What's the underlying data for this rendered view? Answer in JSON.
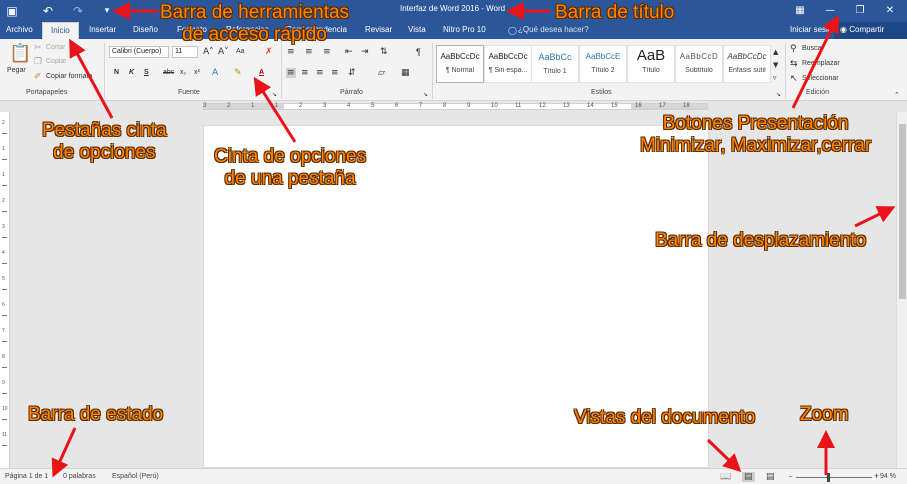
{
  "window": {
    "title": "Interfaz de Word 2016 - Word",
    "sign_in": "Iniciar sesión",
    "share": "Compartir",
    "tell_me": "¿Qué desea hacer?",
    "accent_color": "#2b579a"
  },
  "quick_access": {
    "save_icon": "save-icon",
    "undo_icon": "undo-icon",
    "redo_icon": "redo-icon",
    "customize_icon": "customize-icon"
  },
  "window_controls": {
    "ribbon_display_icon": "ribbon-display-icon",
    "minimize_icon": "minimize-icon",
    "restore_icon": "restore-icon",
    "close_icon": "close-icon"
  },
  "tabs": [
    {
      "label": "Archivo"
    },
    {
      "label": "Inicio"
    },
    {
      "label": "Insertar"
    },
    {
      "label": "Diseño"
    },
    {
      "label": "Formato"
    },
    {
      "label": "Referencias"
    },
    {
      "label": "Correspondencia"
    },
    {
      "label": "Revisar"
    },
    {
      "label": "Vista"
    },
    {
      "label": "Nitro Pro 10"
    }
  ],
  "ribbon": {
    "clipboard": {
      "paste": "Pegar",
      "cut": "Cortar",
      "copy": "Copiar",
      "format_painter": "Copiar formato",
      "group_label": "Portapapeles"
    },
    "font": {
      "font_name": "Calibri (Cuerpo)",
      "font_size": "11",
      "change_case": "Aa",
      "bold": "N",
      "italic": "K",
      "underline": "S",
      "strikethrough": "abc",
      "subscript": "x₂",
      "superscript": "x²",
      "text_color": "A",
      "group_label": "Fuente"
    },
    "paragraph": {
      "pilcrow": "¶",
      "group_label": "Párrafo"
    },
    "styles": {
      "items": [
        {
          "sample": "AaBbCcDc",
          "name": "¶ Normal"
        },
        {
          "sample": "AaBbCcDc",
          "name": "¶ Sin espa..."
        },
        {
          "sample": "AaBbCc",
          "name": "Título 1"
        },
        {
          "sample": "AaBbCcE",
          "name": "Título 2"
        },
        {
          "sample": "AaB",
          "name": "Título"
        },
        {
          "sample": "AaBbCcD",
          "name": "Subtítulo"
        },
        {
          "sample": "AaBbCcDc",
          "name": "Énfasis sutil"
        }
      ],
      "group_label": "Estilos"
    },
    "editing": {
      "find": "Buscar",
      "replace": "Reemplazar",
      "select": "Seleccionar",
      "group_label": "Edición"
    }
  },
  "ruler": {
    "h_labels": [
      "3",
      "2",
      "1",
      "1",
      "2",
      "3",
      "4",
      "5",
      "6",
      "7",
      "8",
      "9",
      "10",
      "11",
      "12",
      "13",
      "14",
      "15",
      "16",
      "17",
      "18"
    ],
    "v_labels": [
      "2",
      "1",
      "1",
      "2",
      "3",
      "4",
      "5",
      "6",
      "7",
      "8",
      "9",
      "10",
      "11"
    ]
  },
  "status": {
    "page": "Página 1 de 1",
    "words": "0 palabras",
    "language": "Español (Perú)",
    "zoom_minus": "-",
    "zoom_plus": "+",
    "zoom": "94 %"
  },
  "annotations": {
    "qat": "Barra de herramientas\nde acceso rápido",
    "title_bar": "Barra de título",
    "tabs": "Pestañas cinta\nde opciones",
    "ribbon": "Cinta de opciones\nde una pestaña",
    "window_buttons": "Botones Presentación\nMinimizar, Maximizar,cerrar",
    "scrollbar": "Barra de desplazamiento",
    "status_bar": "Barra de estado",
    "views": "Vistas del documento",
    "zoom": "Zoom",
    "text_color": "#ff8400",
    "arrow_color": "#e8141a"
  }
}
